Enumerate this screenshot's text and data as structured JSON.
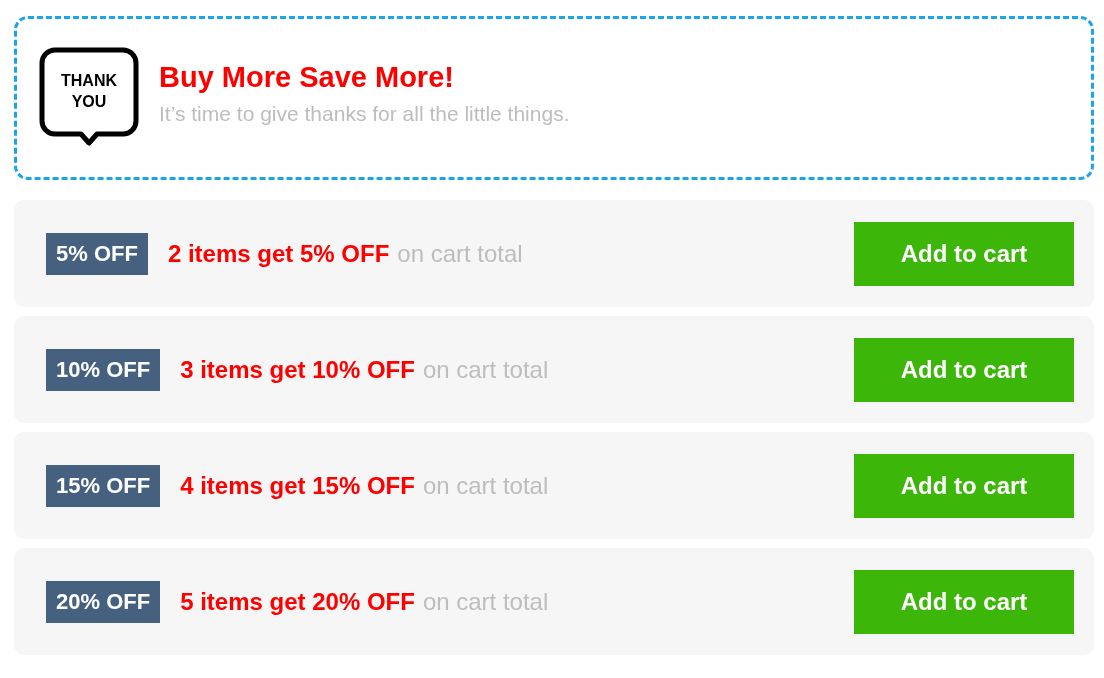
{
  "header": {
    "icon_text": "THANK YOU",
    "title": "Buy More Save More!",
    "subtitle": "It’s time to give thanks for all the little things."
  },
  "offers": [
    {
      "badge": "5% OFF",
      "title": "2 items get 5% OFF",
      "suffix": "on cart total",
      "button": "Add to cart"
    },
    {
      "badge": "10% OFF",
      "title": "3 items get 10% OFF",
      "suffix": "on cart total",
      "button": "Add to cart"
    },
    {
      "badge": "15% OFF",
      "title": "4 items get 15% OFF",
      "suffix": "on cart total",
      "button": "Add to cart"
    },
    {
      "badge": "20% OFF",
      "title": "5 items get 20% OFF",
      "suffix": "on cart total",
      "button": "Add to cart"
    }
  ]
}
